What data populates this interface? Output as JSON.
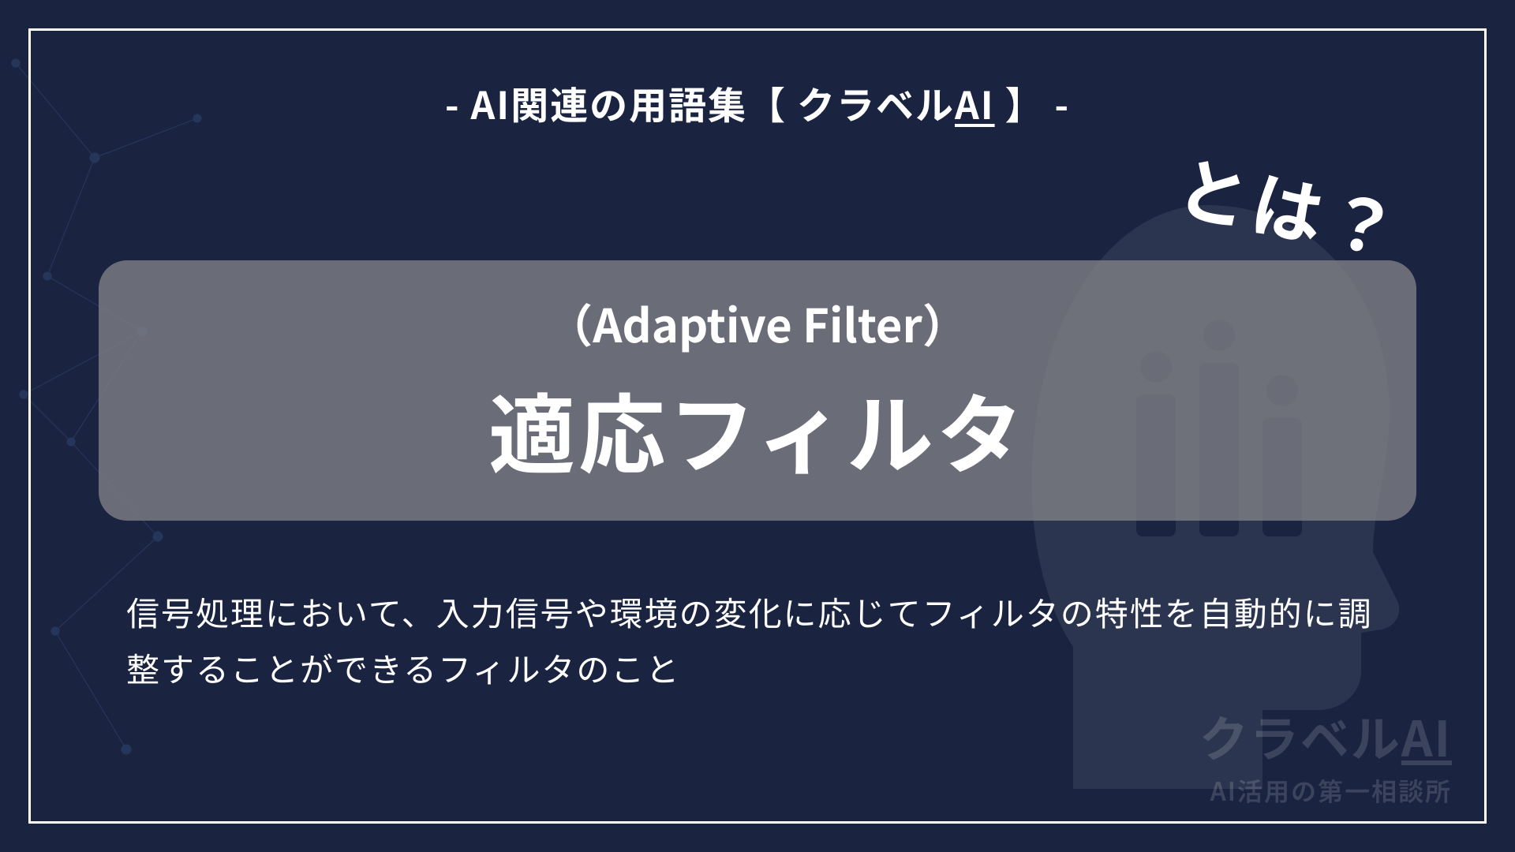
{
  "header": {
    "prefix": "- AI関連の用語集【 クラベル",
    "ai": "AI",
    "suffix": " 】 -"
  },
  "callout": {
    "toha": "とは？"
  },
  "term": {
    "english": "（Adaptive Filter）",
    "japanese": "適応フィルタ"
  },
  "description": {
    "text": "信号処理において、入力信号や環境の変化に応じてフィルタの特性を自動的に調整することができるフィルタのこと"
  },
  "brand": {
    "name_prefix": "クラベル",
    "name_ai": "AI",
    "tagline": "AI活用の第一相談所"
  }
}
